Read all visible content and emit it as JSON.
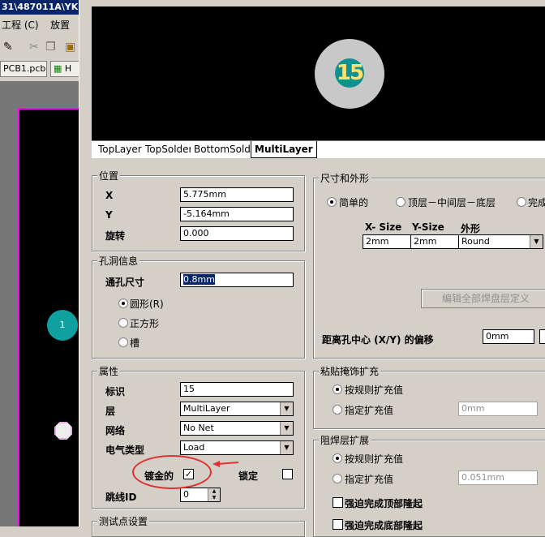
{
  "background_app": {
    "title": "31\\487011A\\YK",
    "menu": [
      "工程 (C)",
      "放置"
    ],
    "doc_tabs": [
      "PCB1.pcb *",
      "H"
    ],
    "pad_label": "1"
  },
  "preview": {
    "pad_label": "15"
  },
  "layer_tabs": [
    "TopLayer",
    "TopSolder",
    "BottomSolder",
    "MultiLayer"
  ],
  "position": {
    "title": "位置",
    "x_label": "X",
    "x_value": "5.775mm",
    "y_label": "Y",
    "y_value": "-5.164mm",
    "rotation_label": "旋转",
    "rotation_value": "0.000"
  },
  "hole": {
    "title": "孔洞信息",
    "size_label": "通孔尺寸",
    "size_value": "0.8mm",
    "shapes": [
      "圆形(R)",
      "正方形",
      "槽"
    ]
  },
  "properties": {
    "title": "属性",
    "designator_label": "标识",
    "designator_value": "15",
    "layer_label": "层",
    "layer_value": "MultiLayer",
    "net_label": "网络",
    "net_value": "No Net",
    "elec_label": "电气类型",
    "elec_value": "Load",
    "plated_label": "镀金的",
    "locked_label": "锁定",
    "jumper_label": "跳线ID",
    "jumper_value": "0"
  },
  "testpoint": {
    "title": "测试点设置"
  },
  "size_shape": {
    "title": "尺寸和外形",
    "modes": [
      "简单的",
      "顶层－中间层－底层",
      "完成"
    ],
    "col_x": "X- Size",
    "col_y": "Y-Size",
    "col_shape": "外形",
    "x_value": "2mm",
    "y_value": "2mm",
    "shape_value": "Round",
    "edit_button": "编辑全部焊盘层定义",
    "offset_label": "距离孔中心 (X/Y) 的偏移",
    "offset_x": "0mm"
  },
  "paste": {
    "title": "粘贴掩饰扩充",
    "rule": "按规则扩充值",
    "specified": "指定扩充值",
    "value": "0mm"
  },
  "solder": {
    "title": "阻焊层扩展",
    "rule": "按规则扩充值",
    "specified": "指定扩充值",
    "value": "0.051mm",
    "force_top": "强迫完成顶部隆起",
    "force_bottom": "强迫完成底部隆起"
  },
  "colors": {
    "annotation": "#e03030",
    "pad": "#10a0a0",
    "selection": "#0a246a"
  }
}
